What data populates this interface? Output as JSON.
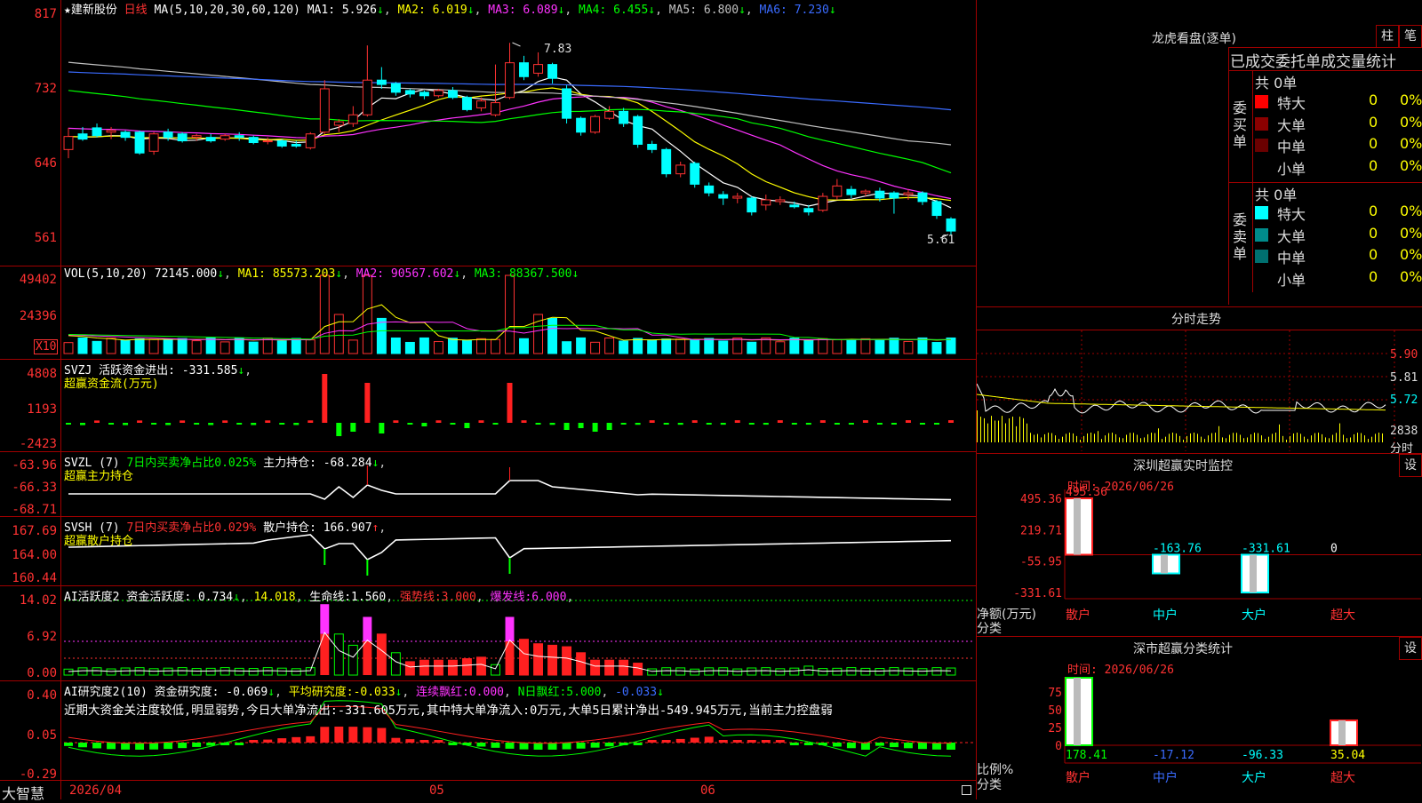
{
  "colors": {
    "up": "#ff3232",
    "down": "#00ffff",
    "grid": "#a00000",
    "bg": "#000000"
  },
  "main": {
    "stock_name": "建新股份",
    "period": "日线",
    "ma_label": "MA(5,10,20,30,60,120)",
    "ma_values": [
      {
        "name": "MA1",
        "value": "5.926"
      },
      {
        "name": "MA2",
        "value": "6.019"
      },
      {
        "name": "MA3",
        "value": "6.089"
      },
      {
        "name": "MA4",
        "value": "6.455"
      },
      {
        "name": "MA5",
        "value": "6.800"
      },
      {
        "name": "MA6",
        "value": "7.230"
      }
    ],
    "y_ticks": [
      "817",
      "732",
      "646",
      "561"
    ],
    "high_label": "7.83",
    "low_label": "5.61"
  },
  "vol": {
    "label": "VOL(5,10,20)",
    "value": "72145.000",
    "ma1": "85573.203",
    "ma2": "90567.602",
    "ma3": "88367.500",
    "y_ticks": [
      "49402",
      "24396"
    ],
    "unit_badge": "X10"
  },
  "svzj": {
    "label": "SVZJ",
    "desc": "活跃资金进出:",
    "value": "-331.585",
    "subtitle": "超赢资金流(万元)",
    "y_ticks": [
      "4808",
      "1193",
      "-2423"
    ]
  },
  "svzl": {
    "label": "SVZL (7)",
    "desc": "7日内买卖净占比0.025%",
    "desc2": "主力持仓:",
    "value": "-68.284",
    "subtitle": "超赢主力持仓",
    "y_ticks": [
      "-63.96",
      "-66.33",
      "-68.71"
    ]
  },
  "svsh": {
    "label": "SVSH (7)",
    "desc": "7日内买卖净占比0.029%",
    "desc2": "散户持仓:",
    "value": "166.907",
    "subtitle": "超赢散户持仓",
    "y_ticks": [
      "167.69",
      "164.00",
      "160.44"
    ]
  },
  "ai1": {
    "label": "AI活跃度2",
    "desc": "资金活跃度:",
    "value": "0.734",
    "v2": "14.018",
    "life_label": "生命线:",
    "life": "1.560",
    "strong_label": "强势线:",
    "strong": "3.000",
    "burst_label": "爆发线:",
    "burst": "6.000",
    "y_ticks": [
      "14.02",
      "6.92",
      "0.00"
    ]
  },
  "ai2": {
    "label": "AI研究度2(10)",
    "desc": "资金研究度:",
    "value": "-0.069",
    "avg_label": "平均研究度:",
    "avg": "-0.033",
    "red_label": "连续飘红:",
    "red": "0.000",
    "nred_label": "N日飘红:",
    "nred": "5.000",
    "extra": "-0.033",
    "comment": "近期大资金关注度较低,明显弱势,今日大单净流出:-331.605万元,其中特大单净流入:0万元,大单5日累计净出-549.945万元,当前主力控盘弱",
    "y_ticks": [
      "0.40",
      "0.05",
      "-0.29"
    ]
  },
  "bottom": {
    "logo": "大智慧",
    "dates": [
      "2026/04",
      "05",
      "06"
    ]
  },
  "longhu": {
    "title": "龙虎看盘(逐单)",
    "btn1": "柱",
    "btn2": "笔",
    "subtitle": "已成交委托单成交量统计",
    "buy_side": "委买单",
    "sell_side": "委卖单",
    "buy_total": "共 0单",
    "sell_total": "共 0单",
    "buy_rows": [
      {
        "label": "特大",
        "count": "0",
        "pct": "0%",
        "color": "#ff0000"
      },
      {
        "label": "大单",
        "count": "0",
        "pct": "0%",
        "color": "#8b0000"
      },
      {
        "label": "中单",
        "count": "0",
        "pct": "0%",
        "color": "#6a0000"
      },
      {
        "label": "小单",
        "count": "0",
        "pct": "0%",
        "color": "#000000"
      }
    ],
    "sell_rows": [
      {
        "label": "特大",
        "count": "0",
        "pct": "0%",
        "color": "#00ffff"
      },
      {
        "label": "大单",
        "count": "0",
        "pct": "0%",
        "color": "#008b8b"
      },
      {
        "label": "中单",
        "count": "0",
        "pct": "0%",
        "color": "#007070"
      },
      {
        "label": "小单",
        "count": "0",
        "pct": "0%",
        "color": "#000000"
      }
    ]
  },
  "intraday": {
    "title": "分时走势",
    "prices": [
      "5.90",
      "5.81",
      "5.72"
    ],
    "vol": "2838",
    "vol_label": "分时"
  },
  "monitor": {
    "title": "深圳超赢实时监控",
    "btn": "设",
    "time": "时间: 2026/06/26",
    "y_ticks": [
      "495.36",
      "219.71",
      "-55.95",
      "-331.61"
    ],
    "y_label": "净额(万元)",
    "x_label": "分类",
    "values": [
      {
        "label": "495.36",
        "v": 495.36
      },
      {
        "label": "-163.76",
        "v": -163.76
      },
      {
        "label": "-331.61",
        "v": -331.61
      },
      {
        "label": "0",
        "v": 0
      }
    ],
    "cats": [
      "散户",
      "中户",
      "大户",
      "超大"
    ]
  },
  "classify": {
    "title": "深市超赢分类统计",
    "btn": "设",
    "time": "时间: 2026/06/26",
    "y_ticks": [
      "75",
      "50",
      "25",
      "0"
    ],
    "y_label": "比例%",
    "x_label": "分类",
    "values": [
      {
        "label": "178.41",
        "v": 178.41,
        "color": "#00ff00"
      },
      {
        "label": "-17.12",
        "v": -17.12,
        "color": "#3a6bff"
      },
      {
        "label": "-96.33",
        "v": -96.33,
        "color": "#00ffff"
      },
      {
        "label": "35.04",
        "v": 35.04,
        "color": "#ffff00"
      }
    ],
    "cats": [
      "散户",
      "中户",
      "大户",
      "超大"
    ]
  },
  "chart_data": {
    "type": "candlestick",
    "title": "建新股份 日线",
    "ylim": [
      5.61,
      8.17
    ],
    "x_ticks": [
      "2026/04",
      "05",
      "06"
    ],
    "high": 7.83,
    "low": 5.61,
    "ohlc": [
      [
        6.6,
        6.85,
        6.5,
        6.75
      ],
      [
        6.78,
        6.86,
        6.7,
        6.72
      ],
      [
        6.85,
        6.9,
        6.74,
        6.76
      ],
      [
        6.8,
        6.86,
        6.72,
        6.82
      ],
      [
        6.8,
        6.82,
        6.7,
        6.74
      ],
      [
        6.8,
        6.82,
        6.54,
        6.56
      ],
      [
        6.58,
        6.8,
        6.54,
        6.78
      ],
      [
        6.8,
        6.84,
        6.7,
        6.74
      ],
      [
        6.78,
        6.8,
        6.68,
        6.7
      ],
      [
        6.74,
        6.78,
        6.7,
        6.76
      ],
      [
        6.74,
        6.78,
        6.68,
        6.7
      ],
      [
        6.72,
        6.78,
        6.7,
        6.76
      ],
      [
        6.76,
        6.8,
        6.7,
        6.74
      ],
      [
        6.74,
        6.76,
        6.66,
        6.68
      ],
      [
        6.7,
        6.74,
        6.66,
        6.7
      ],
      [
        6.7,
        6.72,
        6.62,
        6.64
      ],
      [
        6.66,
        6.7,
        6.62,
        6.64
      ],
      [
        6.62,
        6.8,
        6.6,
        6.78
      ],
      [
        6.8,
        7.4,
        6.78,
        7.3
      ],
      [
        6.88,
        6.95,
        6.8,
        6.92
      ],
      [
        6.9,
        7.1,
        6.86,
        7.0
      ],
      [
        7.0,
        7.8,
        6.98,
        7.4
      ],
      [
        7.4,
        7.55,
        7.3,
        7.35
      ],
      [
        7.36,
        7.38,
        7.22,
        7.26
      ],
      [
        7.28,
        7.3,
        7.2,
        7.24
      ],
      [
        7.26,
        7.28,
        7.18,
        7.22
      ],
      [
        7.22,
        7.3,
        7.2,
        7.28
      ],
      [
        7.28,
        7.32,
        7.18,
        7.2
      ],
      [
        7.2,
        7.22,
        7.04,
        7.06
      ],
      [
        7.08,
        7.2,
        7.04,
        7.16
      ],
      [
        7.0,
        7.58,
        6.98,
        7.14
      ],
      [
        7.2,
        7.83,
        7.18,
        7.6
      ],
      [
        7.6,
        7.68,
        7.4,
        7.44
      ],
      [
        7.48,
        7.72,
        7.44,
        7.58
      ],
      [
        7.58,
        7.6,
        7.36,
        7.42
      ],
      [
        7.3,
        7.34,
        6.9,
        6.96
      ],
      [
        6.96,
        6.98,
        6.76,
        6.8
      ],
      [
        6.8,
        7.0,
        6.78,
        6.98
      ],
      [
        6.96,
        7.1,
        6.94,
        7.04
      ],
      [
        7.04,
        7.08,
        6.86,
        6.9
      ],
      [
        6.98,
        7.0,
        6.62,
        6.66
      ],
      [
        6.66,
        6.7,
        6.56,
        6.6
      ],
      [
        6.6,
        6.62,
        6.28,
        6.32
      ],
      [
        6.32,
        6.46,
        6.28,
        6.42
      ],
      [
        6.44,
        6.46,
        6.16,
        6.2
      ],
      [
        6.18,
        6.22,
        6.06,
        6.1
      ],
      [
        6.08,
        6.12,
        5.96,
        6.04
      ],
      [
        6.04,
        6.1,
        5.98,
        6.06
      ],
      [
        6.04,
        6.06,
        5.84,
        5.88
      ],
      [
        5.96,
        6.08,
        5.9,
        6.02
      ],
      [
        6.0,
        6.06,
        5.96,
        6.02
      ],
      [
        5.96,
        6.0,
        5.92,
        5.94
      ],
      [
        5.92,
        5.96,
        5.84,
        5.88
      ],
      [
        5.9,
        6.1,
        5.88,
        6.06
      ],
      [
        6.06,
        6.26,
        6.02,
        6.18
      ],
      [
        6.14,
        6.18,
        6.04,
        6.08
      ],
      [
        6.1,
        6.14,
        6.06,
        6.12
      ],
      [
        6.12,
        6.16,
        6.0,
        6.04
      ],
      [
        6.1,
        6.12,
        5.86,
        6.04
      ],
      [
        6.08,
        6.14,
        6.02,
        6.1
      ],
      [
        6.1,
        6.12,
        5.96,
        6.0
      ],
      [
        6.0,
        6.02,
        5.8,
        5.84
      ],
      [
        5.8,
        5.82,
        5.61,
        5.66
      ]
    ]
  }
}
